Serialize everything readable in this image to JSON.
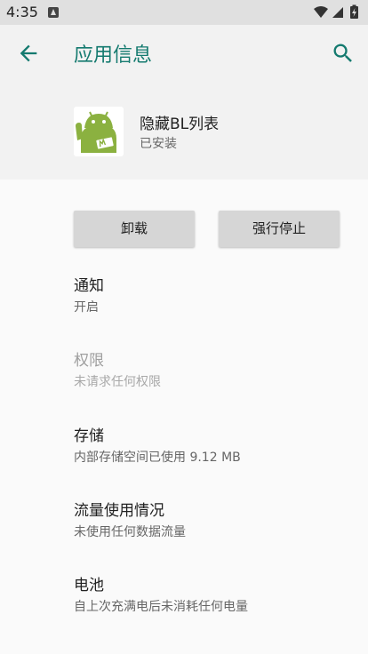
{
  "status_bar": {
    "time": "4:35"
  },
  "app_bar": {
    "title": "应用信息"
  },
  "app_header": {
    "name": "隐藏BL列表",
    "status": "已安装"
  },
  "buttons": {
    "uninstall": "卸载",
    "force_stop": "强行停止"
  },
  "items": [
    {
      "title": "通知",
      "subtitle": "开启",
      "enabled": true
    },
    {
      "title": "权限",
      "subtitle": "未请求任何权限",
      "enabled": false
    },
    {
      "title": "存储",
      "subtitle": "内部存储空间已使用 9.12 MB",
      "enabled": true
    },
    {
      "title": "流量使用情况",
      "subtitle": "未使用任何数据流量",
      "enabled": true
    },
    {
      "title": "电池",
      "subtitle": "自上次充满电后未消耗任何电量",
      "enabled": true
    }
  ],
  "colors": {
    "accent": "#147a6f",
    "status_bar": "#e0e0e0",
    "app_bar": "#f2f2f2",
    "button": "#d6d6d6"
  },
  "icons": {
    "back": "arrow-back-icon",
    "search": "search-icon",
    "app": "android-app-icon",
    "wifi": "wifi-icon",
    "cellular": "cellular-signal-icon",
    "battery": "battery-charging-icon",
    "notification": "app-notification-icon"
  }
}
